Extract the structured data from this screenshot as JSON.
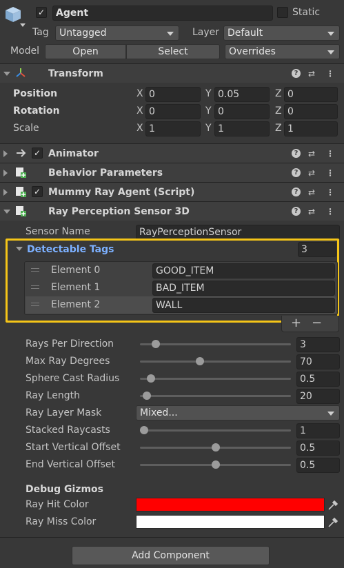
{
  "header": {
    "object_name": "Agent",
    "static_label": "Static",
    "tag_label": "Tag",
    "tag_value": "Untagged",
    "layer_label": "Layer",
    "layer_value": "Default",
    "model_label": "Model",
    "open_label": "Open",
    "select_label": "Select",
    "overrides_label": "Overrides"
  },
  "transform": {
    "title": "Transform",
    "rows": [
      {
        "label": "Position",
        "x": "0",
        "y": "0.05",
        "z": "0"
      },
      {
        "label": "Rotation",
        "x": "0",
        "y": "0",
        "z": "0"
      },
      {
        "label": "Scale",
        "x": "1",
        "y": "1",
        "z": "1"
      }
    ],
    "axis_x": "X",
    "axis_y": "Y",
    "axis_z": "Z"
  },
  "components": {
    "animator": "Animator",
    "behavior": "Behavior Parameters",
    "mummy": "Mummy Ray Agent (Script)",
    "ray": "Ray Perception Sensor 3D"
  },
  "ray_sensor": {
    "sensor_name_label": "Sensor Name",
    "sensor_name_value": "RayPerceptionSensor",
    "detectable_tags_label": "Detectable Tags",
    "detectable_tags_count": "3",
    "elements": [
      {
        "label": "Element 0",
        "value": "GOOD_ITEM"
      },
      {
        "label": "Element 1",
        "value": "BAD_ITEM"
      },
      {
        "label": "Element 2",
        "value": "WALL"
      }
    ],
    "add_symbol": "+",
    "remove_symbol": "−",
    "rays_per_direction_label": "Rays Per Direction",
    "rays_per_direction": "3",
    "rays_per_direction_fraction": 0.08,
    "max_ray_degrees_label": "Max Ray Degrees",
    "max_ray_degrees": "70",
    "max_ray_degrees_fraction": 0.389,
    "sphere_cast_radius_label": "Sphere Cast Radius",
    "sphere_cast_radius": "0.5",
    "sphere_cast_radius_fraction": 0.05,
    "ray_length_label": "Ray Length",
    "ray_length": "20",
    "ray_length_fraction": 0.02,
    "ray_layer_mask_label": "Ray Layer Mask",
    "ray_layer_mask": "Mixed...",
    "stacked_raycasts_label": "Stacked Raycasts",
    "stacked_raycasts": "1",
    "stacked_raycasts_fraction": 0.0,
    "start_vertical_offset_label": "Start Vertical Offset",
    "start_vertical_offset": "0.5",
    "start_vertical_offset_fraction": 0.5,
    "end_vertical_offset_label": "End Vertical Offset",
    "end_vertical_offset": "0.5",
    "end_vertical_offset_fraction": 0.5,
    "debug_gizmos_label": "Debug Gizmos",
    "ray_hit_color_label": "Ray Hit Color",
    "ray_hit_color": "#ff0000",
    "ray_miss_color_label": "Ray Miss Color",
    "ray_miss_color": "#ffffff"
  },
  "add_component_label": "Add Component",
  "colors": {
    "highlight_border": "#f5c518",
    "accent_text": "#7cb0ff"
  }
}
